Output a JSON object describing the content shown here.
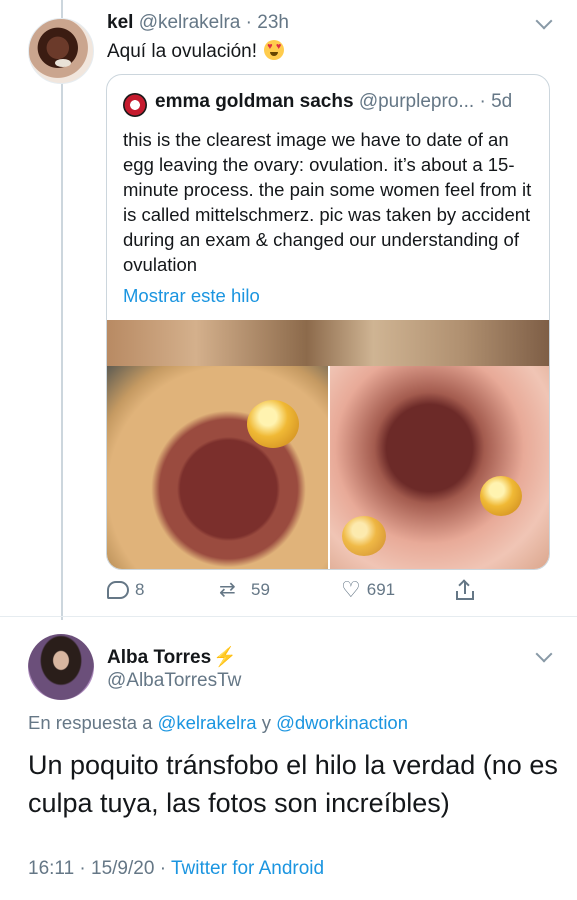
{
  "tweet": {
    "name": "kel",
    "handle": "@kelrakelra",
    "time": "23h",
    "text": "Aquí la ovulación!",
    "emoji": "heart-eyes-emoji",
    "quote": {
      "name": "emma goldman sachs",
      "handle": "@purplepro...",
      "time": "5d",
      "text": "this is the clearest image we have to date of an egg leaving the ovary: ovulation. it’s about a 15-minute process. the pain some women feel from it is called mittelschmerz. pic was taken by accident during an exam & changed our understanding of ovulation",
      "thread_link": "Mostrar este hilo"
    },
    "actions": {
      "replies": "8",
      "retweets": "59",
      "likes": "691"
    }
  },
  "reply": {
    "name": "Alba Torres",
    "badge": "⚡",
    "handle": "@AlbaTorresTw",
    "reply_prefix": "En respuesta a",
    "mention1": "@kelrakelra",
    "conj": "y",
    "mention2": "@dworkinaction",
    "text": "Un poquito tránsfobo el hilo la verdad (no es culpa tuya, las fotos son increíbles)",
    "date": "16:11 · 15/9/20 ·",
    "source": "Twitter for Android"
  },
  "colors": {
    "link": "#1b95e0",
    "secondary_text": "#657786",
    "border": "#ccd6dd"
  }
}
